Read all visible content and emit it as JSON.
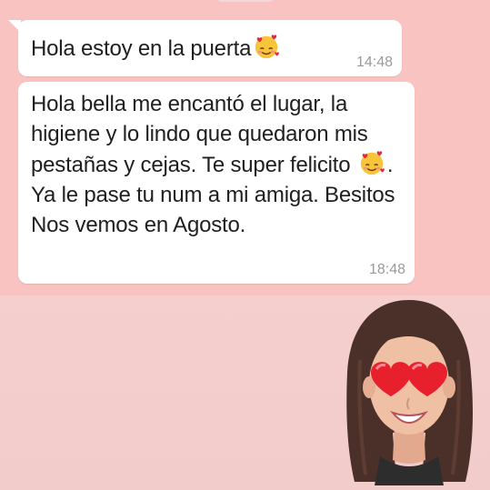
{
  "chat": {
    "messages": [
      {
        "text_before_emoji": "Hola estoy en la puerta",
        "emoji": "smiling-face-with-hearts",
        "text_after_emoji": "",
        "time": "14:48"
      },
      {
        "text_before_emoji": "Hola bella me encantó el lugar, la higiene y lo lindo que quedaron mis pestañas y cejas. Te super felicito",
        "emoji": "smiling-face-with-hearts",
        "text_after_emoji": ". Ya le pase tu num a mi amiga. Besitos Nos vemos en Agosto.",
        "time": "18:48"
      }
    ]
  },
  "sticker": {
    "name": "memoji-heart-eyes"
  },
  "colors": {
    "background_top": "#f8c3c0",
    "background_bottom": "#f4cfcd",
    "bubble": "#ffffff",
    "message_text": "#1f1f1f",
    "timestamp": "#9a9a9a"
  }
}
